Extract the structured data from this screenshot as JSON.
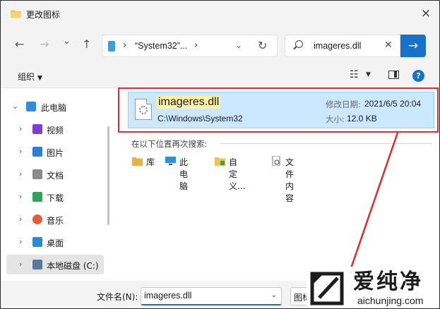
{
  "window": {
    "title": "更改图标",
    "close_icon": "×"
  },
  "nav": {
    "back_icon": "←",
    "forward_icon": "→",
    "recent_icon": "⌄",
    "up_icon": "↑",
    "address_sep1": "›",
    "address_path": "“System32”...",
    "address_sep2": "›",
    "address_dropdown": "⌄",
    "refresh_icon": "↻"
  },
  "search": {
    "value": "imageres.dll",
    "clear_icon": "✕",
    "go_icon": "→"
  },
  "toolbar": {
    "organize_label": "组织",
    "organize_caret": "▼",
    "view_icon": "☷",
    "view_caret": "▼",
    "help_label": "?"
  },
  "sidebar": {
    "items": [
      {
        "label": "此电脑",
        "chevron": "⌄",
        "color": "#2f8fd8"
      },
      {
        "label": "视频",
        "chevron": "›",
        "color": "#7b3fd6"
      },
      {
        "label": "图片",
        "chevron": "›",
        "color": "#2b7fd6"
      },
      {
        "label": "文档",
        "chevron": "›",
        "color": "#8a8a8a"
      },
      {
        "label": "下载",
        "chevron": "›",
        "color": "#2fa35a"
      },
      {
        "label": "音乐",
        "chevron": "›",
        "color": "#e0603a"
      },
      {
        "label": "桌面",
        "chevron": "›",
        "color": "#2a8ad4"
      },
      {
        "label": "本地磁盘 (C:)",
        "chevron": "›",
        "color": "#5a7a9a"
      }
    ]
  },
  "result": {
    "name": "imageres.dll",
    "path": "C:\\Windows\\System32",
    "modified_label": "修改日期:",
    "modified_value": "2021/6/5 20:04",
    "size_label": "大小:",
    "size_value": "12.0 KB"
  },
  "search_again": {
    "label": "在以下位置再次搜索:",
    "items": [
      {
        "label": "库",
        "icon": "library-icon"
      },
      {
        "label": "此电脑",
        "icon": "computer-icon"
      },
      {
        "label": "自定义...",
        "icon": "custom-folder-icon"
      },
      {
        "label": "文件内容",
        "icon": "file-content-icon"
      }
    ]
  },
  "bottom": {
    "filename_label": "文件名(N):",
    "filename_value": "imageres.dll",
    "dropdown_icon": "⌄",
    "type_label": "图标"
  },
  "watermark": {
    "name": "爱纯净",
    "url": "aichunjing.com"
  },
  "colors": {
    "accent": "#1573c9",
    "selection": "#cce8ff",
    "highlight_box": "#e4292c"
  }
}
